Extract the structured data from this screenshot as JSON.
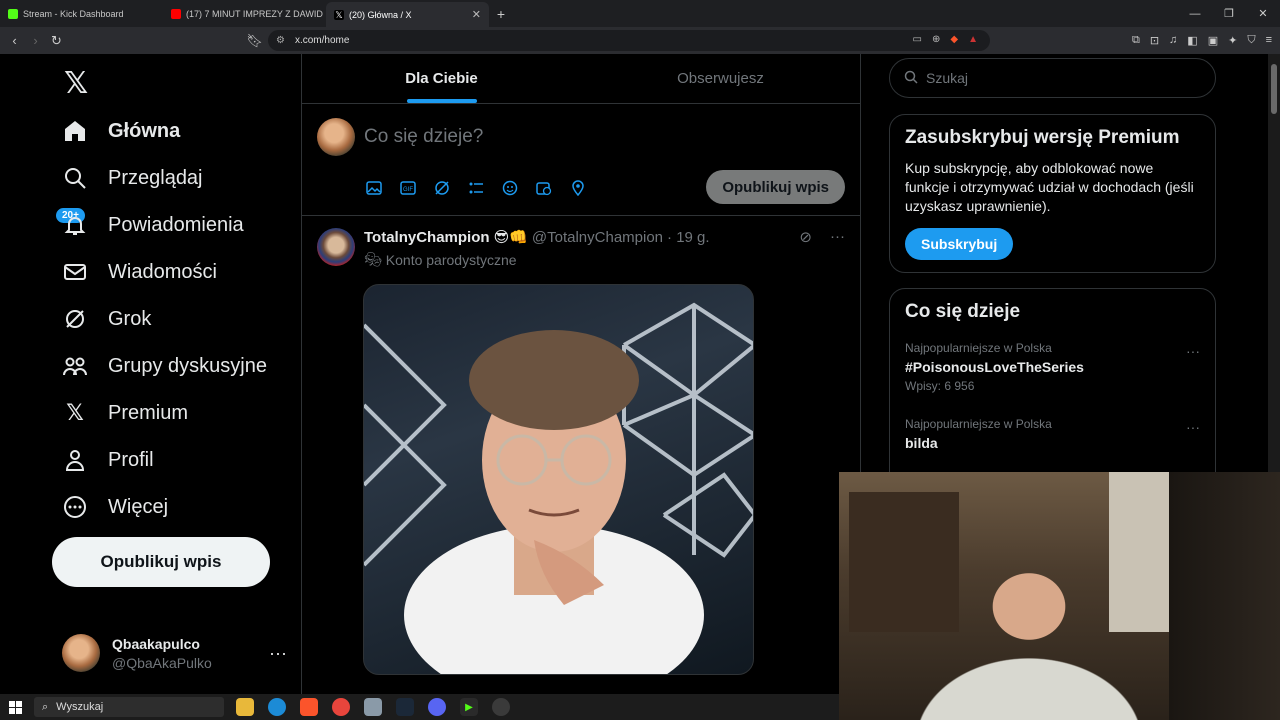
{
  "browser": {
    "tabs": [
      {
        "title": "Stream - Kick Dashboard",
        "color": "#53fc18"
      },
      {
        "title": "(17) 7 MINUT IMPREZY Z DAWID",
        "color": "#ff0000"
      },
      {
        "title": "(20) Główna / X",
        "color": "#ffffff"
      }
    ],
    "url": "x.com/home"
  },
  "nav": {
    "items": [
      {
        "label": "Główna",
        "icon": "home-icon"
      },
      {
        "label": "Przeglądaj",
        "icon": "search-icon"
      },
      {
        "label": "Powiadomienia",
        "icon": "bell-icon"
      },
      {
        "label": "Wiadomości",
        "icon": "mail-icon"
      },
      {
        "label": "Grok",
        "icon": "grok-icon"
      },
      {
        "label": "Grupy dyskusyjne",
        "icon": "communities-icon"
      },
      {
        "label": "Premium",
        "icon": "x-premium-icon"
      },
      {
        "label": "Profil",
        "icon": "profile-icon"
      },
      {
        "label": "Więcej",
        "icon": "more-icon"
      }
    ],
    "notifications_badge": "20+",
    "post_button": "Opublikuj wpis"
  },
  "account": {
    "name": "Qbaakapulco",
    "handle": "@QbaAkaPulko"
  },
  "feed": {
    "tabs": [
      "Dla Ciebie",
      "Obserwujesz"
    ],
    "compose_placeholder": "Co się dzieje?",
    "compose_post_button": "Opublikuj wpis"
  },
  "tweet": {
    "name": "TotalnyChampion",
    "emojis": "😎👊",
    "handle": "@TotalnyChampion",
    "time": "· 19 g.",
    "parody_label": "Konto parodystyczne"
  },
  "sidebar": {
    "search_placeholder": "Szukaj",
    "premium": {
      "title": "Zasubskrybuj wersję Premium",
      "text": "Kup subskrypcję, aby odblokować nowe funkcje i otrzymywać udział w dochodach (jeśli uzyskasz uprawnienie).",
      "button": "Subskrybuj"
    },
    "trending_title": "Co się dzieje",
    "trends": [
      {
        "context": "Najpopularniejsze w Polska",
        "topic": "#PoisonousLoveTheSeries",
        "count": "Wpisy: 6 956"
      },
      {
        "context": "Najpopularniejsze w Polska",
        "topic": "bilda",
        "count": ""
      }
    ]
  },
  "taskbar": {
    "search": "Wyszukaj"
  }
}
